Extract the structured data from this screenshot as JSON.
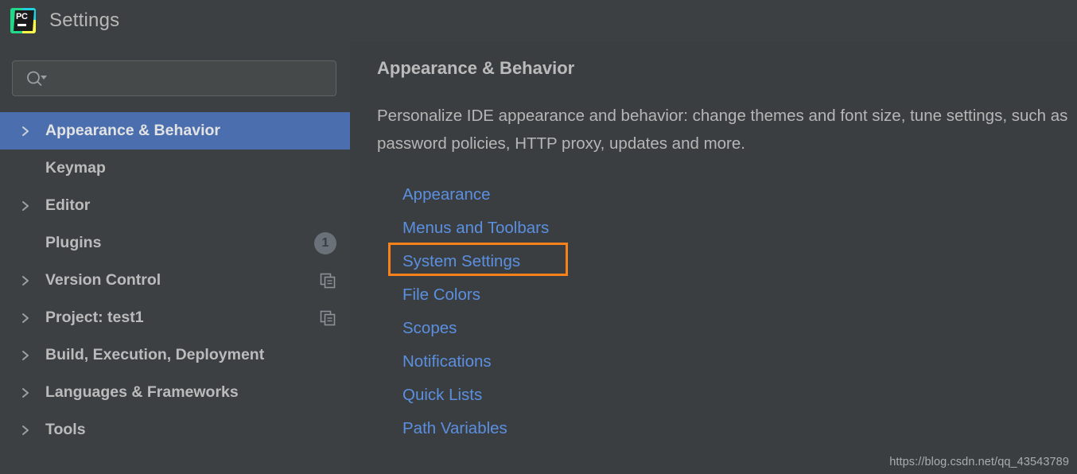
{
  "window": {
    "title": "Settings",
    "app_icon": "pycharm-logo-icon"
  },
  "search": {
    "value": "",
    "placeholder": "",
    "icon": "search-icon"
  },
  "sidebar": {
    "items": [
      {
        "label": "Appearance & Behavior",
        "expandable": true,
        "selected": true,
        "badge": null,
        "trailing_icon": null
      },
      {
        "label": "Keymap",
        "expandable": false,
        "selected": false,
        "badge": null,
        "trailing_icon": null
      },
      {
        "label": "Editor",
        "expandable": true,
        "selected": false,
        "badge": null,
        "trailing_icon": null
      },
      {
        "label": "Plugins",
        "expandable": false,
        "selected": false,
        "badge": "1",
        "trailing_icon": null
      },
      {
        "label": "Version Control",
        "expandable": true,
        "selected": false,
        "badge": null,
        "trailing_icon": "copy-icon"
      },
      {
        "label": "Project: test1",
        "expandable": true,
        "selected": false,
        "badge": null,
        "trailing_icon": "copy-icon"
      },
      {
        "label": "Build, Execution, Deployment",
        "expandable": true,
        "selected": false,
        "badge": null,
        "trailing_icon": null
      },
      {
        "label": "Languages & Frameworks",
        "expandable": true,
        "selected": false,
        "badge": null,
        "trailing_icon": null
      },
      {
        "label": "Tools",
        "expandable": true,
        "selected": false,
        "badge": null,
        "trailing_icon": null
      }
    ]
  },
  "main": {
    "title": "Appearance & Behavior",
    "description": "Personalize IDE appearance and behavior: change themes and font size, tune settings, such as password policies, HTTP proxy, updates and more.",
    "links": [
      {
        "label": "Appearance",
        "highlighted": false
      },
      {
        "label": "Menus and Toolbars",
        "highlighted": false
      },
      {
        "label": "System Settings",
        "highlighted": true
      },
      {
        "label": "File Colors",
        "highlighted": false
      },
      {
        "label": "Scopes",
        "highlighted": false
      },
      {
        "label": "Notifications",
        "highlighted": false
      },
      {
        "label": "Quick Lists",
        "highlighted": false
      },
      {
        "label": "Path Variables",
        "highlighted": false
      }
    ]
  },
  "annotation": {
    "target": "System Settings",
    "color": "#f7821b",
    "shape": "rectangle-outline"
  },
  "watermark": {
    "text": "https://blog.csdn.net/qq_43543789"
  },
  "colors": {
    "window_bg": "#3b3e40",
    "titlebar_bg": "#3c4043",
    "sidebar_bg": "#3c4043",
    "selection_blue": "#4b6eaf",
    "link_blue": "#5b8fe0",
    "text_primary": "#bbbbbb",
    "annotation_orange": "#f7821b"
  }
}
